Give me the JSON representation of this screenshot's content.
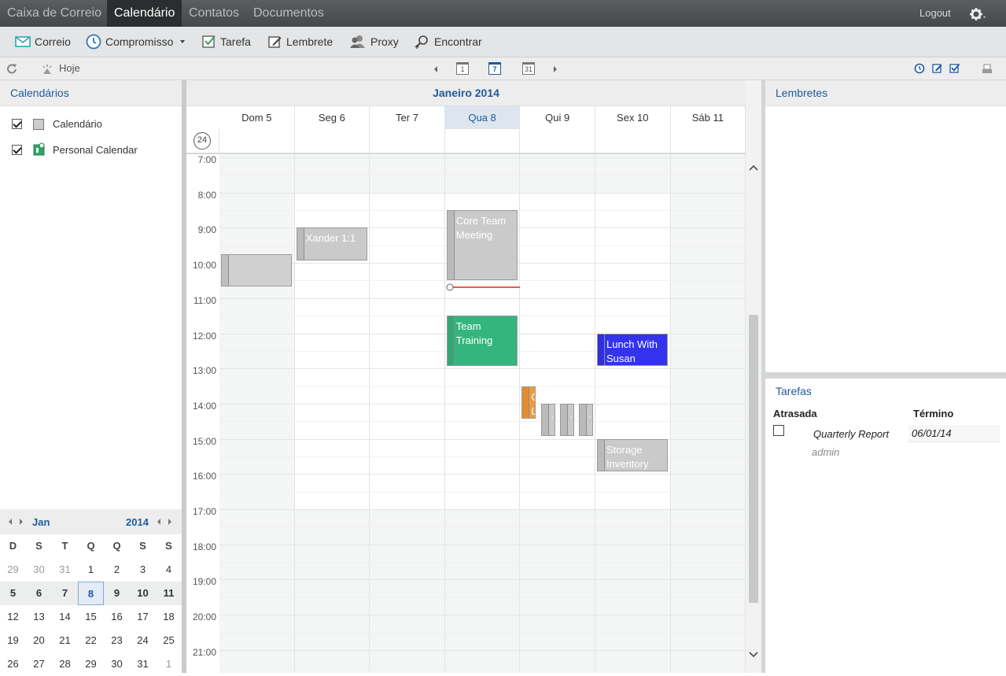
{
  "topnav": {
    "items": [
      {
        "label": "Caixa de Correio",
        "active": false
      },
      {
        "label": "Calendário",
        "active": true
      },
      {
        "label": "Contatos",
        "active": false
      },
      {
        "label": "Documentos",
        "active": false
      }
    ],
    "logout": "Logout"
  },
  "toolbar": {
    "mail": "Correio",
    "appointment": "Compromisso",
    "task": "Tarefa",
    "reminder": "Lembrete",
    "proxy": "Proxy",
    "find": "Encontrar"
  },
  "toolbar2": {
    "today": "Hoje",
    "view_day": "1",
    "view_week": "7",
    "view_month": "31"
  },
  "left": {
    "header": "Calendários",
    "calendars": [
      {
        "name": "Calendário",
        "checked": true,
        "color": "#cccccc"
      },
      {
        "name": "Personal Calendar",
        "checked": true,
        "color": "#2ea66a"
      }
    ]
  },
  "minical": {
    "month": "Jan",
    "year": "2014",
    "weekdays": [
      "D",
      "S",
      "T",
      "Q",
      "Q",
      "S",
      "S"
    ],
    "weeks": [
      [
        "29",
        "30",
        "31",
        "1",
        "2",
        "3",
        "4"
      ],
      [
        "5",
        "6",
        "7",
        "8",
        "9",
        "10",
        "11"
      ],
      [
        "12",
        "13",
        "14",
        "15",
        "16",
        "17",
        "18"
      ],
      [
        "19",
        "20",
        "21",
        "22",
        "23",
        "24",
        "25"
      ],
      [
        "26",
        "27",
        "28",
        "29",
        "30",
        "31",
        "1"
      ]
    ],
    "current_week": 1,
    "today": "8"
  },
  "calendar": {
    "month_title": "Janeiro 2014",
    "week_number": "24",
    "days": [
      "Dom 5",
      "Seg 6",
      "Ter 7",
      "Qua 8",
      "Qui 9",
      "Sex 10",
      "Sáb 11"
    ],
    "today_index": 3,
    "hours": [
      "7:00",
      "8:00",
      "9:00",
      "10:00",
      "11:00",
      "12:00",
      "13:00",
      "14:00",
      "15:00",
      "16:00",
      "17:00",
      "18:00",
      "19:00",
      "20:00",
      "21:00"
    ],
    "events": [
      {
        "title": "",
        "color": "#d0d0d0"
      },
      {
        "title": "Xander 1:1",
        "color": "#cacaca"
      },
      {
        "title": "Core Team Meeting",
        "color": "#cacaca"
      },
      {
        "title": "Team Training",
        "color": "#35b57e"
      },
      {
        "title": "Lunch With Susan",
        "color": "#3333ee"
      },
      {
        "title": "C L",
        "color": "#f29a3a"
      },
      {
        "title": "..",
        "color": "#cacaca"
      },
      {
        "title": "..",
        "color": "#cacaca"
      },
      {
        "title": "..",
        "color": "#cacaca"
      },
      {
        "title": "Storage Inventory",
        "color": "#cacaca"
      }
    ]
  },
  "right": {
    "reminders_header": "Lembretes",
    "tasks_header": "Tarefas",
    "tasks_col_overdue": "Atrasada",
    "tasks_col_due": "Término",
    "tasks": [
      {
        "title": "Quarterly Report",
        "due": "06/01/14",
        "owner": "admin"
      }
    ]
  },
  "colors": {
    "accent": "#1f5b9a",
    "now_line": "#e55b4a"
  }
}
